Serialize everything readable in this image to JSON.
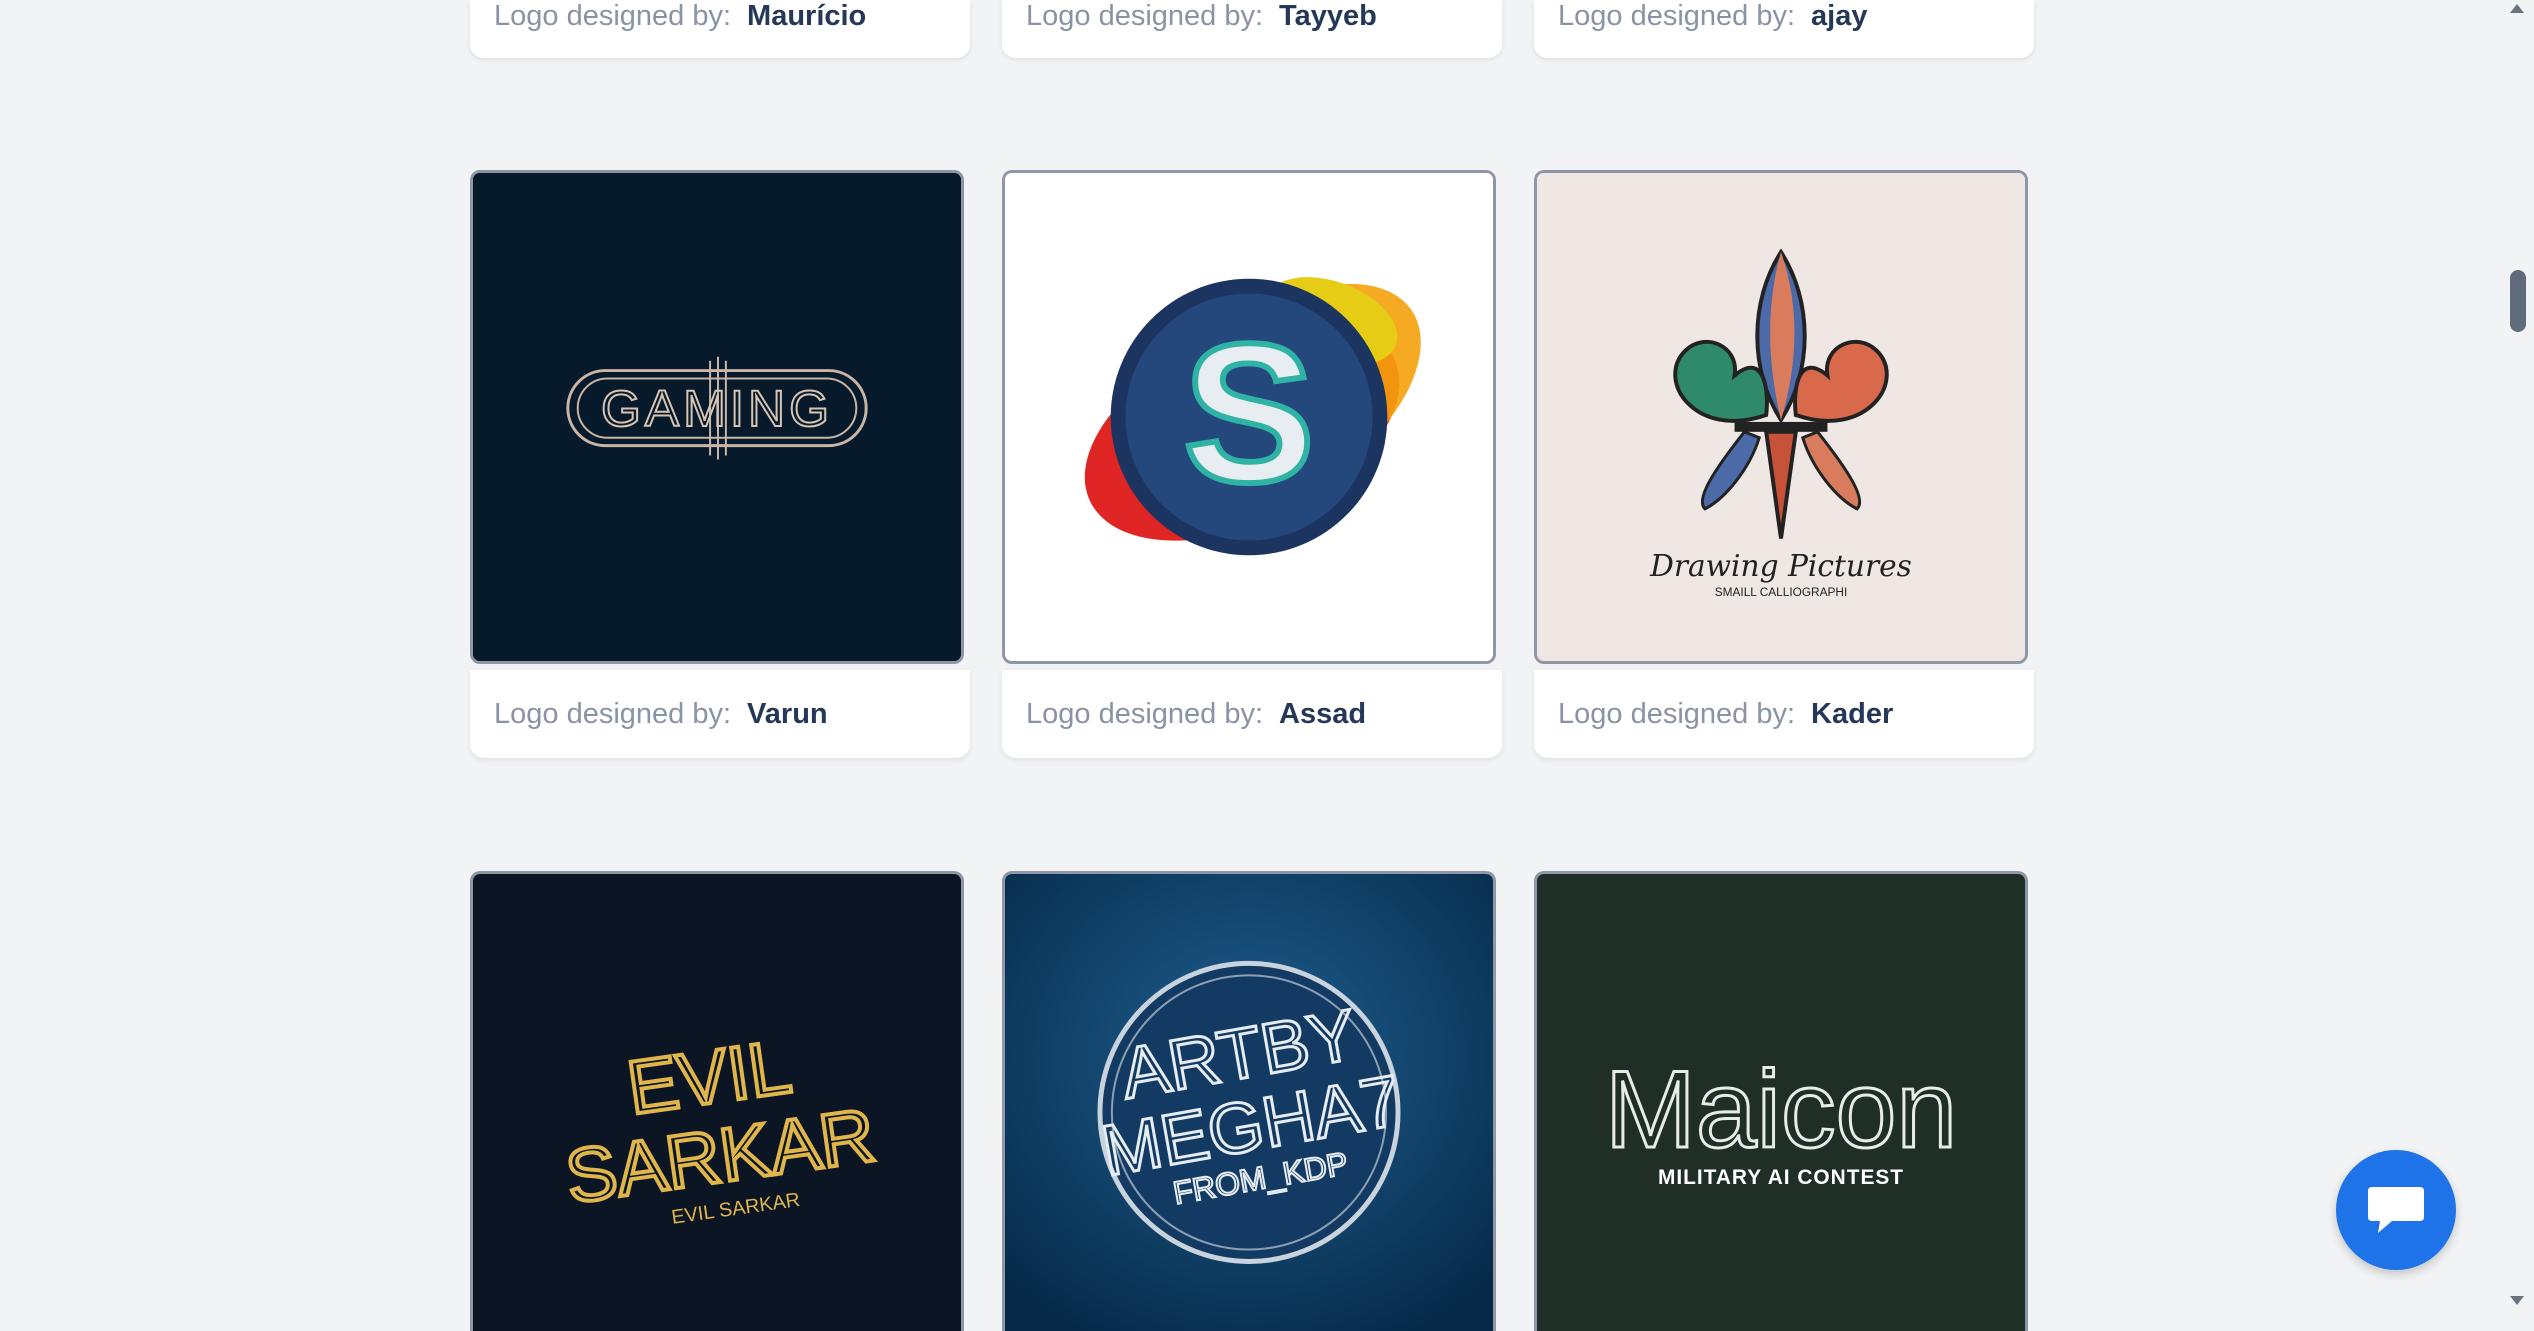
{
  "caption_label": "Logo designed by:",
  "rows": [
    {
      "cards": [
        {
          "designer": "Maurício"
        },
        {
          "designer": "Tayyeb"
        },
        {
          "designer": "ajay"
        }
      ]
    },
    {
      "cards": [
        {
          "designer": "Varun",
          "logo_text": "GAMING"
        },
        {
          "designer": "Assad",
          "logo_text": "S"
        },
        {
          "designer": "Kader",
          "logo_text": "Drawing Pictures",
          "logo_subtext": "SMAILL CALLIOGRAPHI"
        }
      ]
    },
    {
      "cards": [
        {
          "logo_text": "EVIL",
          "logo_text2": "SARKAR",
          "logo_subtext": "EVIL SARKAR"
        },
        {
          "logo_text": "ARTBY",
          "logo_text2": "MEGHA7",
          "logo_subtext": "FROM_KDP"
        },
        {
          "logo_text": "Maicon",
          "logo_subtext": "MILITARY AI CONTEST"
        }
      ]
    }
  ],
  "chat": {
    "icon": "chat-bubble-icon"
  }
}
